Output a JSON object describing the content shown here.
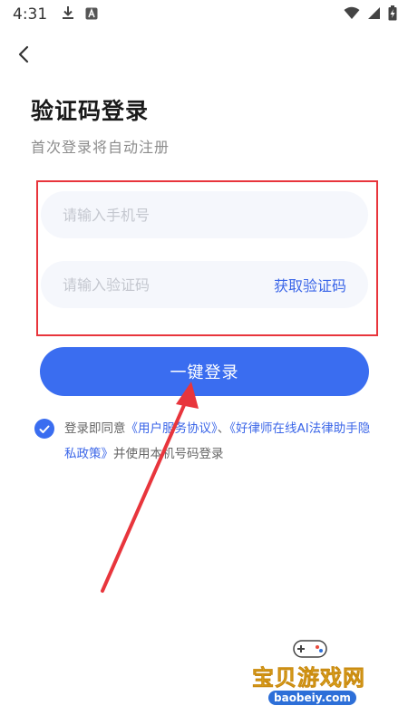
{
  "status_bar": {
    "time": "4:31",
    "left_icons": [
      "download-icon",
      "accessibility-icon"
    ],
    "right_icons": [
      "wifi-icon",
      "signal-icon",
      "battery-charging-icon"
    ]
  },
  "nav": {
    "back_icon": "chevron-left-icon"
  },
  "header": {
    "title": "验证码登录",
    "subtitle": "首次登录将自动注册"
  },
  "form": {
    "phone_placeholder": "请输入手机号",
    "phone_value": "",
    "code_placeholder": "请输入验证码",
    "code_value": "",
    "get_code_label": "获取验证码",
    "login_label": "一键登录"
  },
  "agreement": {
    "checked": true,
    "prefix": "登录即同意",
    "link1": "《用户服务协议》",
    "separator": "、",
    "link2": "《好律师在线AI法律助手隐私政策》",
    "suffix": "并使用本机号码登录"
  },
  "annotation": {
    "highlight_color": "#e8353c",
    "arrow_color": "#e8353c"
  },
  "watermark": {
    "title": "宝贝游戏网",
    "domain": "baobeiy.com"
  },
  "colors": {
    "primary": "#3a6df0",
    "link": "#3b66e8",
    "input_bg": "#f5f7fc"
  }
}
